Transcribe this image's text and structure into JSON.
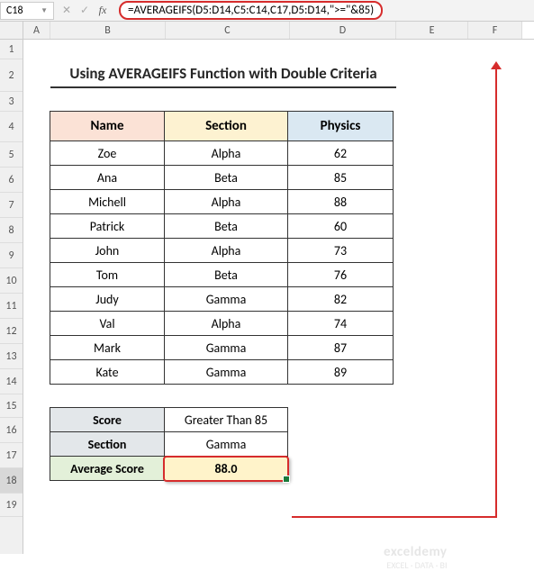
{
  "namebox": "C18",
  "formula": "=AVERAGEIFS(D5:D14,C5:C14,C17,D5:D14,\">=\"&85)",
  "columns": [
    "A",
    "B",
    "C",
    "D",
    "E",
    "F"
  ],
  "rows": [
    "1",
    "2",
    "3",
    "4",
    "5",
    "6",
    "7",
    "8",
    "9",
    "10",
    "11",
    "12",
    "13",
    "14",
    "15",
    "16",
    "17",
    "18",
    "19"
  ],
  "title": "Using AVERAGEIFS Function with Double Criteria",
  "headers": {
    "name": "Name",
    "section": "Section",
    "physics": "Physics"
  },
  "data": [
    {
      "name": "Zoe",
      "section": "Alpha",
      "physics": 62
    },
    {
      "name": "Ana",
      "section": "Beta",
      "physics": 85
    },
    {
      "name": "Michell",
      "section": "Alpha",
      "physics": 88
    },
    {
      "name": "Patrick",
      "section": "Beta",
      "physics": 60
    },
    {
      "name": "John",
      "section": "Alpha",
      "physics": 73
    },
    {
      "name": "Tom",
      "section": "Beta",
      "physics": 76
    },
    {
      "name": "Judy",
      "section": "Gamma",
      "physics": 82
    },
    {
      "name": "Val",
      "section": "Alpha",
      "physics": 74
    },
    {
      "name": "Mark",
      "section": "Gamma",
      "physics": 87
    },
    {
      "name": "Kate",
      "section": "Gamma",
      "physics": 89
    }
  ],
  "criteria": {
    "score_label": "Score",
    "score_value": "Greater Than 85",
    "section_label": "Section",
    "section_value": "Gamma",
    "avg_label": "Average Score",
    "avg_value": "88.0"
  },
  "watermark": {
    "brand": "exceldemy",
    "sub": "EXCEL · DATA · BI"
  },
  "chart_data": {
    "type": "table",
    "title": "Using AVERAGEIFS Function with Double Criteria",
    "columns": [
      "Name",
      "Section",
      "Physics"
    ],
    "rows": [
      [
        "Zoe",
        "Alpha",
        62
      ],
      [
        "Ana",
        "Beta",
        85
      ],
      [
        "Michell",
        "Alpha",
        88
      ],
      [
        "Patrick",
        "Beta",
        60
      ],
      [
        "John",
        "Alpha",
        73
      ],
      [
        "Tom",
        "Beta",
        76
      ],
      [
        "Judy",
        "Gamma",
        82
      ],
      [
        "Val",
        "Alpha",
        74
      ],
      [
        "Mark",
        "Gamma",
        87
      ],
      [
        "Kate",
        "Gamma",
        89
      ]
    ],
    "criteria": {
      "Score": "Greater Than 85",
      "Section": "Gamma"
    },
    "result": {
      "Average Score": 88.0
    }
  }
}
